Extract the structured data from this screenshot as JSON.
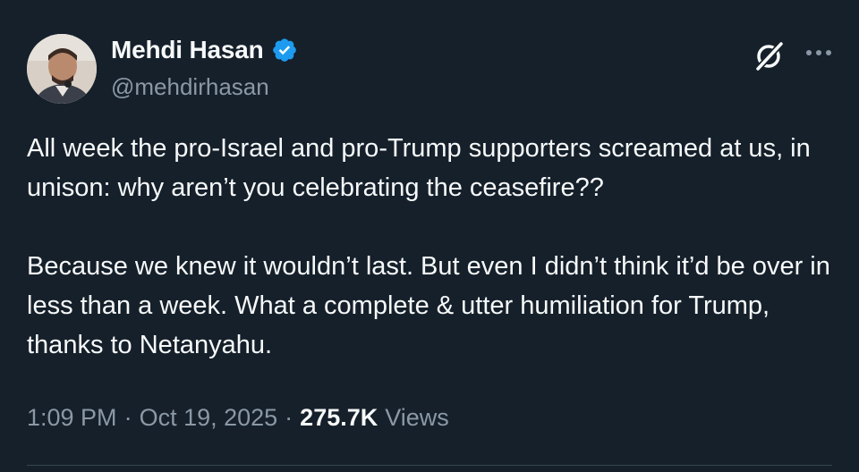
{
  "author": {
    "display_name": "Mehdi Hasan",
    "handle": "@mehdirhasan",
    "verified": true
  },
  "tweet": {
    "text": "All week the pro-Israel and pro-Trump supporters screamed at us, in unison: why aren’t you celebrating the ceasefire??\n\nBecause we knew it wouldn’t last. But even I didn’t think it’d be over in less than a week. What a complete & utter humiliation for Trump, thanks to Netanyahu."
  },
  "meta": {
    "time": "1:09 PM",
    "separator": "·",
    "date": "Oct 19, 2025",
    "views_count": "275.7K",
    "views_label": "Views"
  },
  "icons": {
    "verified": "verified-badge-icon",
    "grok": "grok-icon",
    "more": "more-options-icon"
  },
  "colors": {
    "background": "#15202b",
    "text_primary": "#f7f9f9",
    "text_secondary": "#8b98a5",
    "verified_blue": "#1d9bf0"
  }
}
